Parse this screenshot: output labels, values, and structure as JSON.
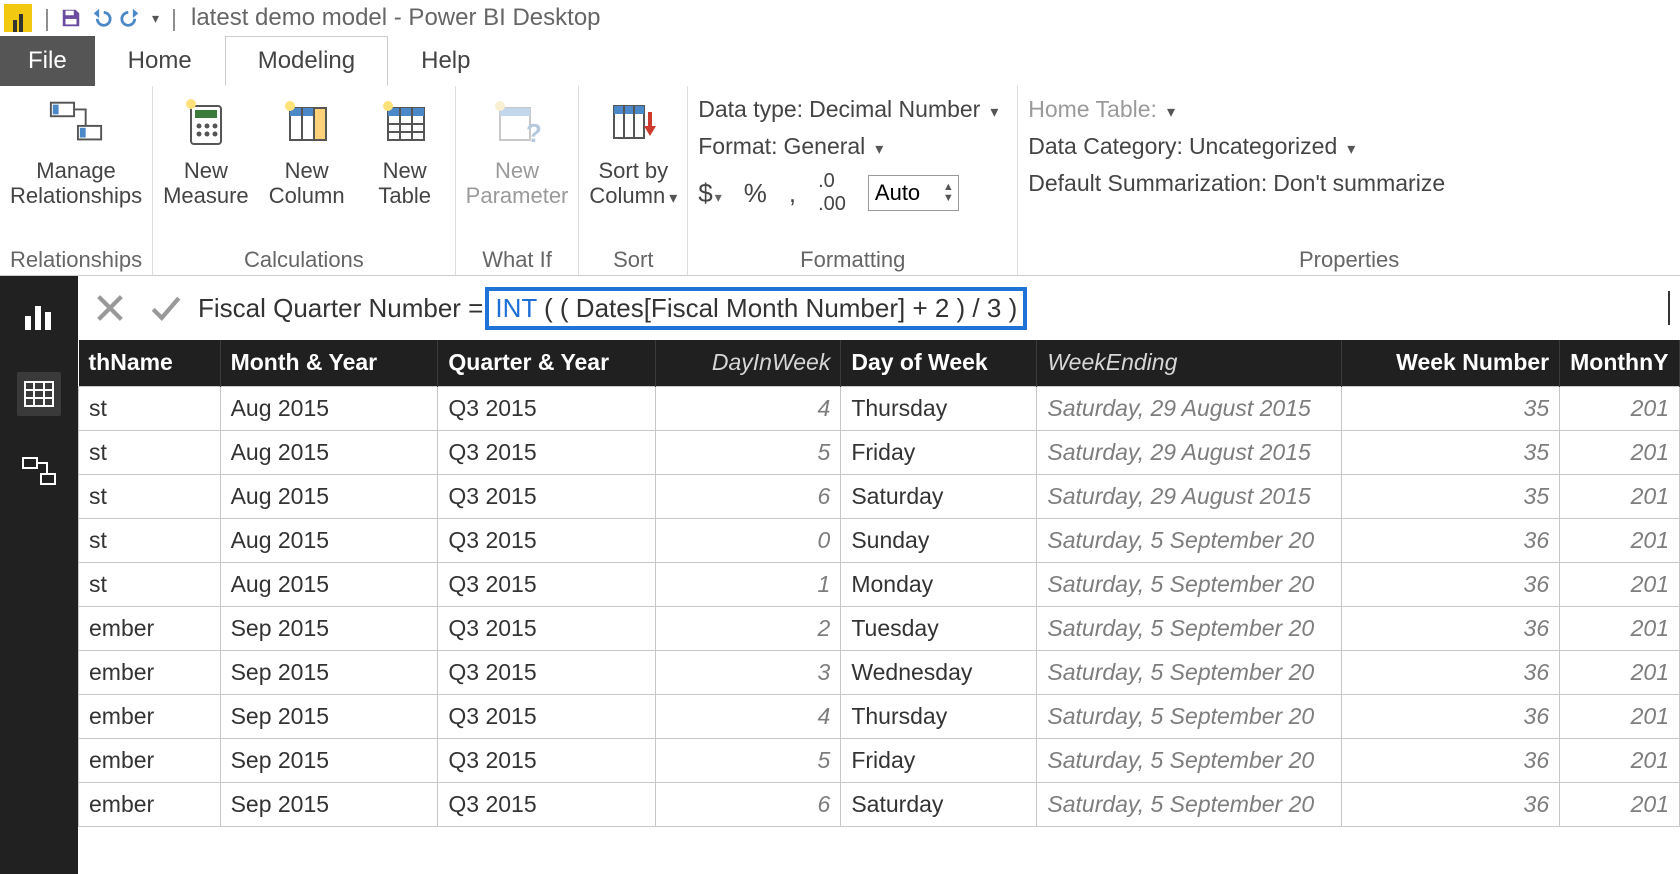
{
  "titlebar": {
    "title": "latest demo model - Power BI Desktop"
  },
  "tabs": {
    "file": "File",
    "home": "Home",
    "modeling": "Modeling",
    "help": "Help"
  },
  "ribbon": {
    "relationships": {
      "manage": "Manage\nRelationships",
      "group": "Relationships"
    },
    "calculations": {
      "measure": "New\nMeasure",
      "column": "New\nColumn",
      "table": "New\nTable",
      "group": "Calculations"
    },
    "whatif": {
      "param": "New\nParameter",
      "group": "What If"
    },
    "sort": {
      "sortby": "Sort by\nColumn",
      "group": "Sort"
    },
    "formatting": {
      "datatype_label": "Data type:",
      "datatype_value": "Decimal Number",
      "format_label": "Format:",
      "format_value": "General",
      "currency": "$",
      "percent": "%",
      "thousands": ",",
      "decimal_places": "Auto",
      "group": "Formatting"
    },
    "properties": {
      "home_table": "Home Table:",
      "data_category_label": "Data Category:",
      "data_category_value": "Uncategorized",
      "default_summ_label": "Default Summarization:",
      "default_summ_value": "Don't summarize",
      "group": "Properties"
    }
  },
  "formula": {
    "lhs": "Fiscal Quarter Number =",
    "kw": "INT",
    "rhs_open": " (",
    "rhs_body": " ( Dates[Fiscal Month Number] + 2 ) / 3 ",
    "rhs_close": ")"
  },
  "grid": {
    "headers": {
      "month_name": "thName",
      "month_year": "Month & Year",
      "quarter_year": "Quarter & Year",
      "day_in_week": "DayInWeek",
      "day_of_week": "Day of Week",
      "week_ending": "WeekEnding",
      "week_number": "Week Number",
      "month_n_year": "MonthnY"
    },
    "rows": [
      {
        "mn": "st",
        "my": "Aug 2015",
        "qy": "Q3 2015",
        "diw": "4",
        "dow": "Thursday",
        "we": "Saturday, 29 August 2015",
        "wn": "35",
        "mny": "201"
      },
      {
        "mn": "st",
        "my": "Aug 2015",
        "qy": "Q3 2015",
        "diw": "5",
        "dow": "Friday",
        "we": "Saturday, 29 August 2015",
        "wn": "35",
        "mny": "201"
      },
      {
        "mn": "st",
        "my": "Aug 2015",
        "qy": "Q3 2015",
        "diw": "6",
        "dow": "Saturday",
        "we": "Saturday, 29 August 2015",
        "wn": "35",
        "mny": "201"
      },
      {
        "mn": "st",
        "my": "Aug 2015",
        "qy": "Q3 2015",
        "diw": "0",
        "dow": "Sunday",
        "we": "Saturday, 5 September 20",
        "wn": "36",
        "mny": "201"
      },
      {
        "mn": "st",
        "my": "Aug 2015",
        "qy": "Q3 2015",
        "diw": "1",
        "dow": "Monday",
        "we": "Saturday, 5 September 20",
        "wn": "36",
        "mny": "201"
      },
      {
        "mn": "ember",
        "my": "Sep 2015",
        "qy": "Q3 2015",
        "diw": "2",
        "dow": "Tuesday",
        "we": "Saturday, 5 September 20",
        "wn": "36",
        "mny": "201"
      },
      {
        "mn": "ember",
        "my": "Sep 2015",
        "qy": "Q3 2015",
        "diw": "3",
        "dow": "Wednesday",
        "we": "Saturday, 5 September 20",
        "wn": "36",
        "mny": "201"
      },
      {
        "mn": "ember",
        "my": "Sep 2015",
        "qy": "Q3 2015",
        "diw": "4",
        "dow": "Thursday",
        "we": "Saturday, 5 September 20",
        "wn": "36",
        "mny": "201"
      },
      {
        "mn": "ember",
        "my": "Sep 2015",
        "qy": "Q3 2015",
        "diw": "5",
        "dow": "Friday",
        "we": "Saturday, 5 September 20",
        "wn": "36",
        "mny": "201"
      },
      {
        "mn": "ember",
        "my": "Sep 2015",
        "qy": "Q3 2015",
        "diw": "6",
        "dow": "Saturday",
        "we": "Saturday, 5 September 20",
        "wn": "36",
        "mny": "201"
      }
    ]
  }
}
